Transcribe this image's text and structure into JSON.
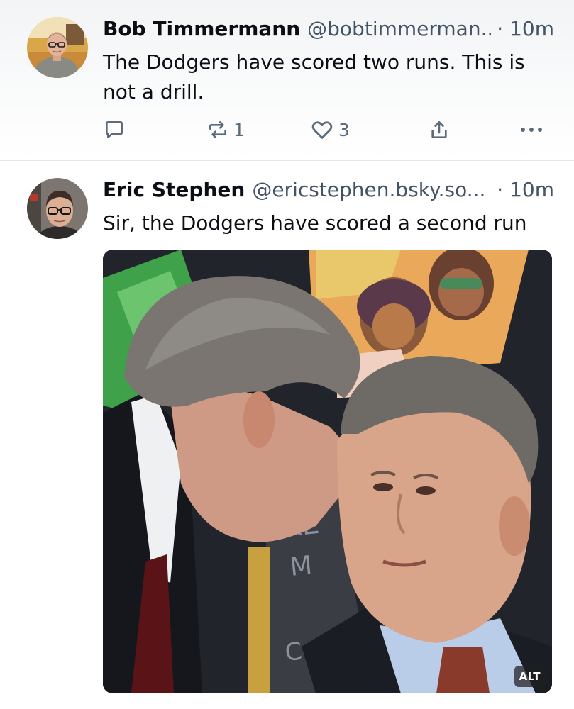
{
  "posts": [
    {
      "author_name": "Bob Timmermann",
      "handle": "@bobtimmerman...",
      "time": "· 10m",
      "text": "The Dodgers have scored two runs. This is not a drill.",
      "avatar_icon": "avatar-photo",
      "actions": {
        "reply_icon": "reply-icon",
        "repost_icon": "repost-icon",
        "repost_count": "1",
        "like_icon": "heart-icon",
        "like_count": "3",
        "share_icon": "share-icon",
        "more_icon": "more-icon"
      }
    },
    {
      "author_name": "Eric Stephen",
      "handle": "@ericstephen.bsky.so...",
      "time": "· 10m",
      "text": "Sir, the Dodgers have scored a second run",
      "avatar_icon": "avatar-photo",
      "image": {
        "alt_badge": "ALT"
      }
    }
  ],
  "colors": {
    "text_primary": "#0b0f14",
    "text_secondary": "#425466",
    "icon_gray": "#5b6b7b",
    "divider": "#e3e6ea"
  }
}
